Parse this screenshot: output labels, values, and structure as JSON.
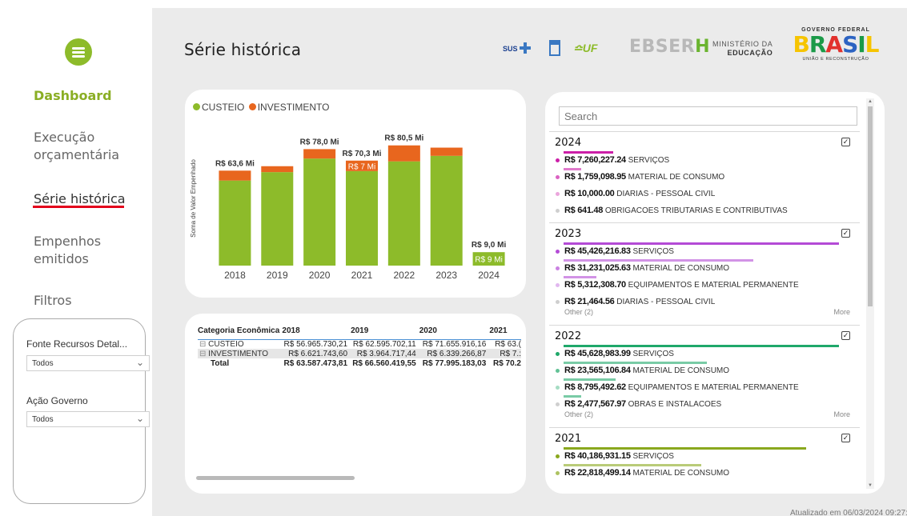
{
  "sidebar": {
    "items": [
      {
        "label": "Dashboard"
      },
      {
        "label": "Execução"
      },
      {
        "label": "orçamentária"
      },
      {
        "label": "Série histórica"
      },
      {
        "label": "Empenhos"
      },
      {
        "label": "emitidos"
      }
    ],
    "filters_label": "Filtros",
    "filter1_label": "Fonte Recursos Detal...",
    "filter1_value": "Todos",
    "filter2_label": "Ação Governo",
    "filter2_value": "Todos"
  },
  "header": {
    "title": "Série histórica",
    "logos": {
      "sus": "SUS",
      "ebserh": "EBSERH",
      "mec_line1": "MINISTÉRIO DA",
      "mec_line2": "EDUCAÇÃO",
      "gov_top": "GOVERNO FEDERAL",
      "gov_main": "BRASIL",
      "gov_sub": "UNIÃO E RECONSTRUÇÃO"
    }
  },
  "chart_data": {
    "type": "bar",
    "ylabel": "Soma de Valor Empenhado",
    "categories": [
      "2018",
      "2019",
      "2020",
      "2021",
      "2022",
      "2023",
      "2024"
    ],
    "series": [
      {
        "name": "CUSTEIO",
        "color": "#8dbb2a",
        "values": [
          56.97,
          62.6,
          71.66,
          63.3,
          69.8,
          73.5,
          9.0
        ]
      },
      {
        "name": "INVESTIMENTO",
        "color": "#e8661e",
        "values": [
          6.62,
          3.96,
          6.34,
          7.0,
          10.7,
          5.5,
          0.0
        ]
      }
    ],
    "total_labels": [
      "R$ 63,6 Mi",
      "",
      "R$ 78,0 Mi",
      "R$ 70,3 Mi",
      "R$ 80,5 Mi",
      "",
      "R$ 9,0 Mi"
    ],
    "inner_labels": [
      {
        "index": 3,
        "series": "INVESTIMENTO",
        "text": "R$ 7 Mi"
      },
      {
        "index": 6,
        "series": "CUSTEIO",
        "text": "R$ 9 Mi"
      }
    ],
    "ylim": [
      0,
      90
    ]
  },
  "matrix": {
    "headers": [
      "Categoria Econômica",
      "2018",
      "2019",
      "2020",
      "2021"
    ],
    "rows": [
      {
        "label": "CUSTEIO",
        "values": [
          "R$ 56.965.730,21",
          "R$ 62.595.702,11",
          "R$ 71.655.916,16",
          "R$ 63.("
        ]
      },
      {
        "label": "INVESTIMENTO",
        "values": [
          "R$ 6.621.743,60",
          "R$ 3.964.717,44",
          "R$ 6.339.266,87",
          "R$ 7.:"
        ]
      }
    ],
    "total": {
      "label": "Total",
      "values": [
        "R$ 63.587.473,81",
        "R$ 66.560.419,55",
        "R$ 77.995.183,03",
        "R$ 70.2"
      ]
    },
    "expand_icon": "⊟"
  },
  "right_panel": {
    "search_placeholder": "Search",
    "years": [
      {
        "year": "2024",
        "color": "#cc1fa8",
        "items": [
          {
            "value": "R$ 7,260,227.24",
            "label": "SERVIÇOS",
            "frac": 0.18
          },
          {
            "value": "R$ 1,759,098.95",
            "label": "MATERIAL DE CONSUMO",
            "frac": 0.04
          },
          {
            "value": "R$ 10,000.00",
            "label": "DIARIAS - PESSOAL CIVIL",
            "frac": 0
          },
          {
            "value": "R$ 641.48",
            "label": "OBRIGACOES TRIBUTARIAS E CONTRIBUTIVAS",
            "frac": 0
          }
        ]
      },
      {
        "year": "2023",
        "color": "#b44bd6",
        "items": [
          {
            "value": "R$ 45,426,216.83",
            "label": "SERVIÇOS",
            "frac": 1.0
          },
          {
            "value": "R$ 31,231,025.63",
            "label": "MATERIAL DE CONSUMO",
            "frac": 0.69
          },
          {
            "value": "R$ 5,312,308.70",
            "label": "EQUIPAMENTOS E MATERIAL PERMANENTE",
            "frac": 0.12
          },
          {
            "value": "R$ 21,464.56",
            "label": "DIARIAS - PESSOAL CIVIL",
            "frac": 0
          }
        ],
        "other": "Other (2)",
        "more": "More"
      },
      {
        "year": "2022",
        "color": "#1fa86a",
        "items": [
          {
            "value": "R$ 45,628,983.99",
            "label": "SERVIÇOS",
            "frac": 1.0
          },
          {
            "value": "R$ 23,565,106.84",
            "label": "MATERIAL DE CONSUMO",
            "frac": 0.52
          },
          {
            "value": "R$ 8,795,492.62",
            "label": "EQUIPAMENTOS E MATERIAL PERMANENTE",
            "frac": 0.19
          },
          {
            "value": "R$ 2,477,567.97",
            "label": "OBRAS E INSTALACOES",
            "frac": 0.05
          }
        ],
        "other": "Other (2)",
        "more": "More"
      },
      {
        "year": "2021",
        "color": "#8aa81e",
        "items": [
          {
            "value": "R$ 40,186,931.15",
            "label": "SERVIÇOS",
            "frac": 0.88
          },
          {
            "value": "R$ 22,818,499.14",
            "label": "MATERIAL DE CONSUMO",
            "frac": 0.5
          }
        ]
      }
    ]
  },
  "footer": {
    "updated": "Atualizado em 06/03/2024 09:27:"
  }
}
